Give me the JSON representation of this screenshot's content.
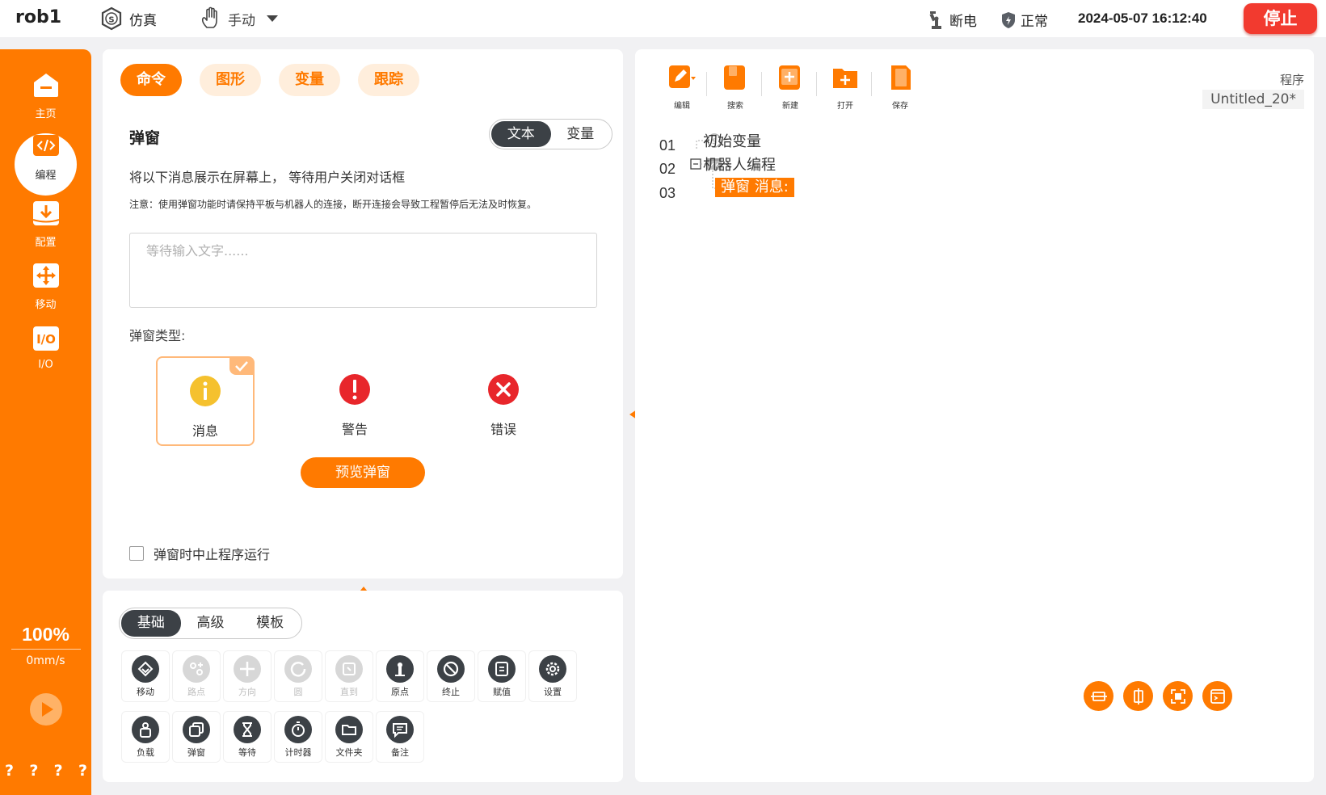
{
  "topbar": {
    "robot_name": "rob1",
    "sim_label": "仿真",
    "mode_label": "手动",
    "power_label": "断电",
    "safety_label": "正常",
    "datetime": "2024-05-07 16:12:40",
    "stop_label": "停止"
  },
  "sidebar": {
    "items": [
      {
        "label": "主页",
        "icon": "home-icon"
      },
      {
        "label": "编程",
        "icon": "code-icon"
      },
      {
        "label": "配置",
        "icon": "download-icon"
      },
      {
        "label": "移动",
        "icon": "move-icon"
      },
      {
        "label": "I/O",
        "icon": "io-icon"
      }
    ],
    "speed_percent": "100%",
    "speed_value": "0mm/s",
    "bottom_marks": [
      "?",
      "?",
      "?",
      "?"
    ]
  },
  "command": {
    "tabs": [
      "命令",
      "图形",
      "变量",
      "跟踪"
    ],
    "title": "弹窗",
    "seg_text": "文本",
    "seg_var": "变量",
    "description": "将以下消息展示在屏幕上， 等待用户关闭对话框",
    "note": "注意：使用弹窗功能时请保持平板与机器人的连接，断开连接会导致工程暂停后无法及时恢复。",
    "input_placeholder": "等待输入文字......",
    "type_label": "弹窗类型:",
    "types": [
      "消息",
      "警告",
      "错误"
    ],
    "selected_type": "消息",
    "preview_label": "预览弹窗",
    "halt_label": "弹窗时中止程序运行",
    "halt_checked": false
  },
  "toolbox": {
    "tabs": [
      "基础",
      "高级",
      "模板"
    ],
    "row1": [
      {
        "label": "移动",
        "enabled": true,
        "icon": "move-tool-icon"
      },
      {
        "label": "路点",
        "enabled": false,
        "icon": "waypoint-icon"
      },
      {
        "label": "方向",
        "enabled": false,
        "icon": "direction-icon"
      },
      {
        "label": "圆",
        "enabled": false,
        "icon": "circle-icon"
      },
      {
        "label": "直到",
        "enabled": false,
        "icon": "until-icon"
      },
      {
        "label": "原点",
        "enabled": true,
        "icon": "origin-icon"
      },
      {
        "label": "终止",
        "enabled": true,
        "icon": "halt-icon"
      },
      {
        "label": "赋值",
        "enabled": true,
        "icon": "assign-icon"
      },
      {
        "label": "设置",
        "enabled": true,
        "icon": "settings-icon"
      }
    ],
    "row2": [
      {
        "label": "负载",
        "enabled": true,
        "icon": "payload-icon"
      },
      {
        "label": "弹窗",
        "enabled": true,
        "icon": "popup-icon"
      },
      {
        "label": "等待",
        "enabled": true,
        "icon": "hourglass-icon"
      },
      {
        "label": "计时器",
        "enabled": true,
        "icon": "timer-icon"
      },
      {
        "label": "文件夹",
        "enabled": true,
        "icon": "folder-icon"
      },
      {
        "label": "备注",
        "enabled": true,
        "icon": "comment-icon"
      }
    ]
  },
  "program": {
    "tools": [
      {
        "label": "编辑",
        "icon": "edit-icon"
      },
      {
        "label": "搜索",
        "icon": "search-icon"
      },
      {
        "label": "新建",
        "icon": "new-file-icon"
      },
      {
        "label": "打开",
        "icon": "open-folder-icon"
      },
      {
        "label": "保存",
        "icon": "save-icon"
      }
    ],
    "label": "程序",
    "name": "Untitled_20*",
    "lines": [
      {
        "num": "01",
        "text": "初始变量"
      },
      {
        "num": "02",
        "text": "机器人编程"
      },
      {
        "num": "03",
        "text": "弹窗 消息:"
      }
    ]
  },
  "colors": {
    "accent": "#ff7a00",
    "stop": "#f23a2f",
    "dark": "#3c4146"
  }
}
